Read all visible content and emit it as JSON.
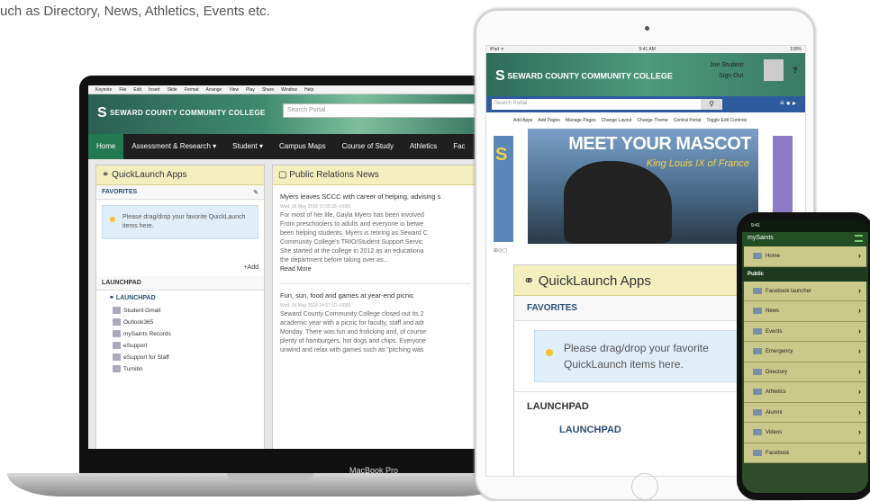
{
  "caption": "uch as Directory, News, Athletics, Events etc.",
  "laptop": {
    "model_label": "MacBook Pro",
    "mac_menu": [
      "Keynote",
      "File",
      "Edit",
      "Insert",
      "Slide",
      "Format",
      "Arrange",
      "View",
      "Play",
      "Share",
      "Window",
      "Help"
    ],
    "college_name": "SEWARD COUNTY COMMUNITY COLLEGE",
    "search_placeholder": "Search Portal",
    "nav": [
      "Home",
      "Assessment & Research ▾",
      "Student ▾",
      "Campus Maps",
      "Course of Study",
      "Athletics",
      "Fac"
    ],
    "quicklaunch": {
      "title": "QuickLaunch Apps",
      "favorites": "FAVORITES",
      "hint": "Please drag/drop your favorite QuickLaunch items here.",
      "add": "+Add",
      "launchpad_header": "LAUNCHPAD",
      "launchpad_link": "LAUNCHPAD",
      "items": [
        "Student Gmail",
        "Outlook365",
        "mySaints Records",
        "eSupport",
        "eSupport for Staff",
        "Turnitin"
      ]
    },
    "news": {
      "title": "Public Relations News",
      "articles": [
        {
          "headline": "Myers leaves SCCC with career of helping, advising s",
          "date": "Wed, 16 May 2018 10:55:28 +0000",
          "lines": [
            "For most of her life, Gayla Myers has been involved",
            "From preschoolers to adults and everyone in betwe",
            "been helping students. Myers is retiring as Seward C",
            "Community College's TRIO/Student Support Servic",
            "She started at the college in 2012 as an educationa",
            "the department before taking over as..."
          ],
          "more": "Read More"
        },
        {
          "headline": "Fun, sun, food and games at year-end picnic",
          "date": "Wed, 16 May 2018 14:57:10 +0000",
          "lines": [
            "Seward County Community College closed out its 2",
            "academic year with a picnic for faculty, staff and adr",
            "Monday. There was fun and frolicking and, of course",
            "plenty of hamburgers, hot dogs and chips. Everyone",
            "unwind and relax with games such as \"pitching was"
          ]
        }
      ]
    }
  },
  "tablet": {
    "status_left": "iPad ᯤ",
    "status_time": "9:41 AM",
    "status_right": "100%",
    "college_name": "SEWARD COUNTY COMMUNITY COLLEGE",
    "user_name": "Joe Student",
    "sign_out": "Sign Out",
    "help": "?",
    "search_placeholder": "Search Portal",
    "search_icon": "search-icon",
    "tools": [
      "Add Apps",
      "Add Pages",
      "Manage Pages",
      "Change Layout",
      "Change Theme",
      "Central Portal",
      "Toggle Edit Controls"
    ],
    "banner_title": "MEET YOUR MASCOT",
    "banner_subtitle": "King Louis IX of France",
    "quicklaunch": {
      "title": "QuickLaunch Apps",
      "favorites": "FAVORITES",
      "hint": "Please drag/drop your favorite QuickLaunch items here.",
      "launchpad_header": "LAUNCHPAD",
      "launchpad_link": "LAUNCHPAD"
    }
  },
  "phone": {
    "status_time": "9:41",
    "app_title": "mySaints",
    "home": "Home",
    "section": "Public",
    "items": [
      "Facebook launcher",
      "News",
      "Events",
      "Emergency",
      "Directory",
      "Athletics",
      "Alumni",
      "Videos",
      "Facebook"
    ]
  }
}
